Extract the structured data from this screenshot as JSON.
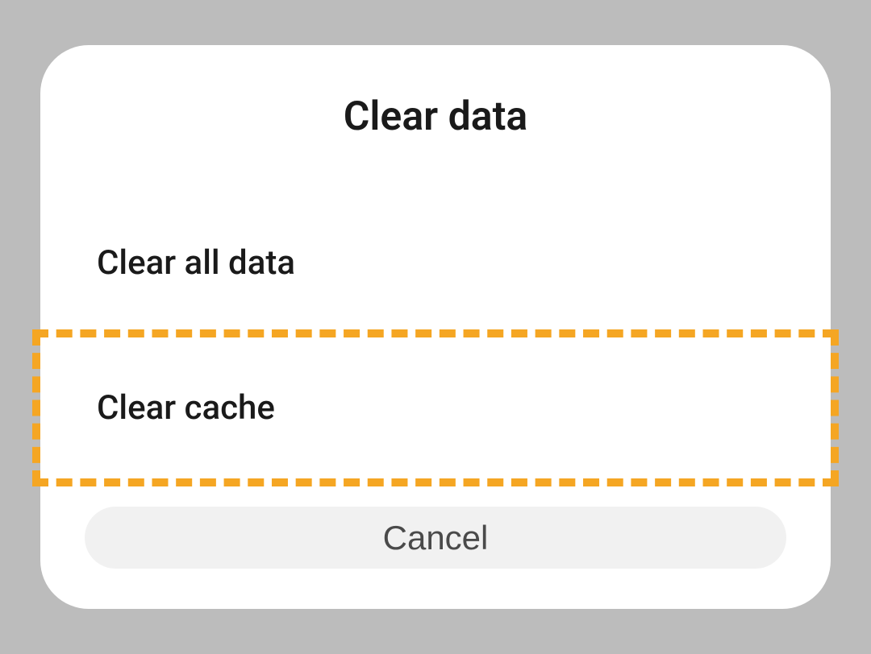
{
  "dialog": {
    "title": "Clear data",
    "options": [
      {
        "label": "Clear all data"
      },
      {
        "label": "Clear cache"
      }
    ],
    "cancel_label": "Cancel"
  }
}
